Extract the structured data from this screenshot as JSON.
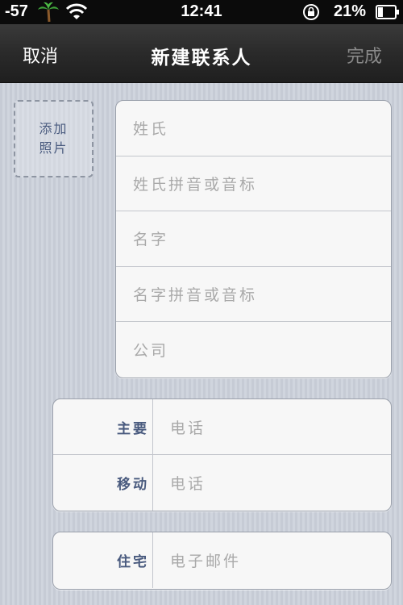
{
  "status_bar": {
    "signal": "-57",
    "time": "12:41",
    "battery": "21%",
    "icons": [
      "palm-tree-icon",
      "wifi-icon",
      "rotation-lock-icon",
      "battery-icon"
    ]
  },
  "nav": {
    "cancel": "取消",
    "title": "新建联系人",
    "done": "完成"
  },
  "photo": {
    "line1": "添加",
    "line2": "照片"
  },
  "name_fields": [
    "姓氏",
    "姓氏拼音或音标",
    "名字",
    "名字拼音或音标",
    "公司"
  ],
  "phones": [
    {
      "label": "主要",
      "placeholder": "电话"
    },
    {
      "label": "移动",
      "placeholder": "电话"
    }
  ],
  "emails": [
    {
      "label": "住宅",
      "placeholder": "电子邮件"
    }
  ],
  "colors": {
    "nav_bg": "#2a2a2a",
    "label_blue": "#4a5b7f",
    "placeholder_gray": "#a9a9a9",
    "background": "#c9ced8"
  }
}
